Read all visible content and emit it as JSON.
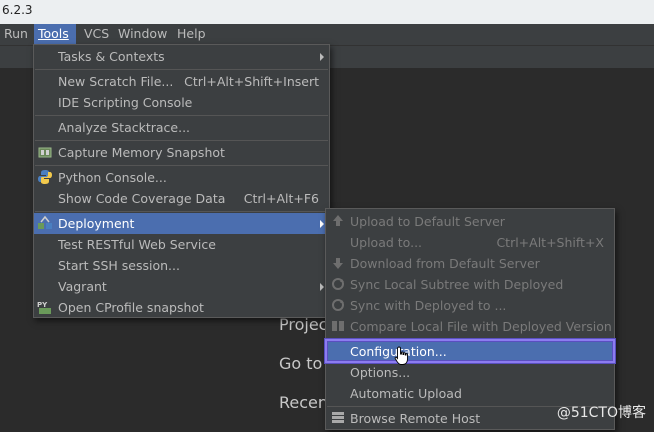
{
  "window": {
    "title": "6.2.3"
  },
  "menubar": {
    "items": [
      {
        "label": "Run",
        "mnemonic": "R"
      },
      {
        "label": "Tools",
        "mnemonic": "T"
      },
      {
        "label": "VCS",
        "mnemonic": "S"
      },
      {
        "label": "Window",
        "mnemonic": "W"
      },
      {
        "label": "Help",
        "mnemonic": "H"
      }
    ]
  },
  "tools_menu": {
    "items": [
      {
        "label": "Tasks & Contexts",
        "submenu": true
      },
      {
        "label": "New Scratch File...",
        "shortcut": "Ctrl+Alt+Shift+Insert"
      },
      {
        "label": "IDE Scripting Console"
      },
      {
        "label": "Analyze Stacktrace..."
      },
      {
        "label": "Capture Memory Snapshot",
        "icon": "memory-snapshot-icon"
      },
      {
        "label": "Python Console...",
        "icon": "python-icon"
      },
      {
        "label": "Show Code Coverage Data",
        "shortcut": "Ctrl+Alt+F6"
      },
      {
        "label": "Deployment",
        "submenu": true,
        "icon": "deployment-icon",
        "highlighted": true
      },
      {
        "label": "Test RESTful Web Service"
      },
      {
        "label": "Start SSH session..."
      },
      {
        "label": "Vagrant",
        "submenu": true
      },
      {
        "label": "Open CProfile snapshot",
        "icon": "cprofile-icon"
      }
    ]
  },
  "deployment_submenu": {
    "items": [
      {
        "label": "Upload to Default Server",
        "icon": "upload-icon",
        "disabled": true
      },
      {
        "label": "Upload to...",
        "shortcut": "Ctrl+Alt+Shift+X",
        "disabled": true
      },
      {
        "label": "Download from Default Server",
        "icon": "download-icon",
        "disabled": true
      },
      {
        "label": "Sync Local Subtree with Deployed",
        "icon": "sync-icon",
        "disabled": true
      },
      {
        "label": "Sync with Deployed to ...",
        "icon": "sync-icon",
        "disabled": true
      },
      {
        "label": "Compare Local File with Deployed Version",
        "icon": "compare-icon",
        "disabled": true
      },
      {
        "label": "Configuration...",
        "highlighted": true
      },
      {
        "label": "Options..."
      },
      {
        "label": "Automatic Upload"
      },
      {
        "label": "Browse Remote Host",
        "icon": "remote-host-icon"
      }
    ]
  },
  "welcome": {
    "line1": "Projec",
    "line2": "Go to",
    "line3": "Recen"
  },
  "watermark": "@51CTO博客",
  "colors": {
    "menu_bg": "#3c3f41",
    "highlight": "#4b6eaf",
    "editor_bg": "#2b2b2b",
    "focus_outline": "#8c7cf0",
    "disabled_text": "#7a7a7a"
  }
}
